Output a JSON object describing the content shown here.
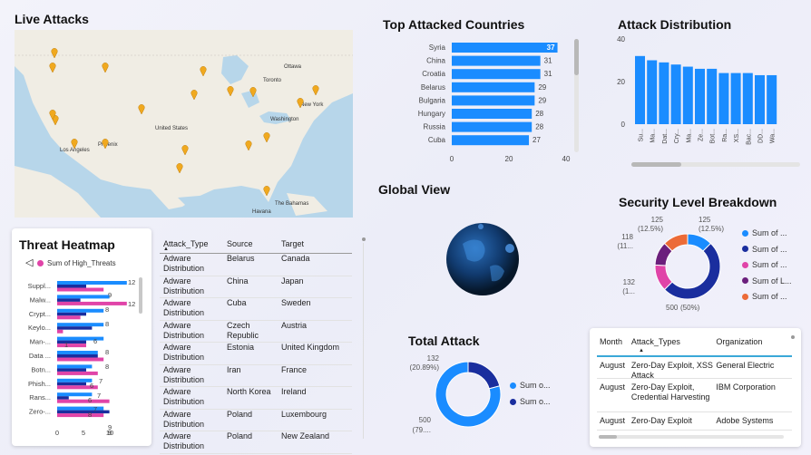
{
  "titles": {
    "live_attacks": "Live Attacks",
    "top_countries": "Top Attacked Countries",
    "attack_distribution": "Attack Distribution",
    "global_view": "Global View",
    "security_level": "Security Level Breakdown",
    "threat_heatmap": "Threat Heatmap",
    "total_attack": "Total Attack"
  },
  "map": {
    "labels": [
      "Ottawa",
      "Toronto",
      "New York",
      "Washington",
      "United States",
      "Los Angeles",
      "Phoenix",
      "The Bahamas",
      "Havana"
    ],
    "pins": 19
  },
  "colors": {
    "bar_blue": "#1a8cff",
    "navy": "#1a2e9e",
    "pink": "#e044a8",
    "purple": "#6b1f7c",
    "orange": "#ec6b37"
  },
  "chart_data": [
    {
      "id": "top_countries",
      "type": "bar",
      "orientation": "horizontal",
      "categories": [
        "Syria",
        "China",
        "Croatia",
        "Belarus",
        "Bulgaria",
        "Hungary",
        "Russia",
        "Cuba"
      ],
      "values": [
        37,
        31,
        31,
        29,
        29,
        28,
        28,
        27
      ],
      "xlim": [
        0,
        40
      ],
      "xticks": [
        "0",
        "20",
        "40"
      ]
    },
    {
      "id": "attack_distribution",
      "type": "bar",
      "categories": [
        "Su...",
        "Ma...",
        "Dat...",
        "Cry...",
        "Ma...",
        "Ze...",
        "Bot...",
        "Ra...",
        "XS...",
        "Bac...",
        "DD...",
        "Wa..."
      ],
      "values": [
        32,
        30,
        29,
        28,
        27,
        26,
        26,
        24,
        24,
        24,
        23,
        23
      ],
      "ylim": [
        0,
        40
      ],
      "yticks": [
        "0",
        "20",
        "40"
      ]
    },
    {
      "id": "security_level",
      "type": "pie",
      "donut": true,
      "slices": [
        {
          "label": "125",
          "pct": "(12.5%)",
          "value": 125,
          "color": "#1a8cff"
        },
        {
          "label": "500",
          "pct": "(50%)",
          "value": 500,
          "color": "#1a2e9e"
        },
        {
          "label": "132",
          "pct": "(1...",
          "value": 132,
          "color": "#e044a8"
        },
        {
          "label": "118",
          "pct": "(11...",
          "value": 118,
          "color": "#6b1f7c"
        },
        {
          "label": "125",
          "pct": "(12.5%)",
          "value": 125,
          "color": "#ec6b37"
        }
      ],
      "legend": [
        "Sum of ...",
        "Sum of ...",
        "Sum of ...",
        "Sum of L...",
        "Sum of ..."
      ]
    },
    {
      "id": "threat_heatmap",
      "type": "bar",
      "orientation": "horizontal",
      "legend": [
        "Sum of High_Threats"
      ],
      "categories": [
        "Suppl...",
        "Malw...",
        "Crypt...",
        "Keylo...",
        "Man-...",
        "Data ...",
        "Botn...",
        "Phish...",
        "Rans...",
        "Zero-..."
      ],
      "series": [
        {
          "color": "#1a8cff",
          "values": [
            12,
            9,
            8,
            8,
            8,
            7,
            6,
            6,
            6,
            8
          ]
        },
        {
          "color": "#1a2e9e",
          "values": [
            5,
            4,
            5,
            6,
            5,
            7,
            5,
            5,
            2,
            9
          ]
        },
        {
          "color": "#e044a8",
          "values": [
            8,
            12,
            4,
            1,
            5,
            8,
            7,
            7,
            9,
            8
          ]
        }
      ],
      "labels": [
        "12",
        "9",
        "12",
        "8",
        "8",
        "6",
        "1",
        "8",
        "8",
        "7",
        "6",
        "7",
        "6",
        "7",
        "8",
        "9",
        "9"
      ],
      "xlim": [
        0,
        10
      ],
      "xticks": [
        "0",
        "5",
        "10"
      ]
    },
    {
      "id": "total_attack",
      "type": "pie",
      "donut": true,
      "slices": [
        {
          "label": "132",
          "pct": "(20.89%)",
          "value": 132,
          "color": "#1a2e9e"
        },
        {
          "label": "500",
          "pct": "(79....",
          "value": 500,
          "color": "#1a8cff"
        }
      ],
      "legend": [
        "Sum o...",
        "Sum o..."
      ]
    }
  ],
  "attack_table": {
    "headers": [
      "Attack_Type",
      "Source",
      "Target"
    ],
    "rows": [
      [
        "Adware Distribution",
        "Belarus",
        "Canada"
      ],
      [
        "Adware Distribution",
        "China",
        "Japan"
      ],
      [
        "Adware Distribution",
        "Cuba",
        "Sweden"
      ],
      [
        "Adware Distribution",
        "Czech Republic",
        "Austria"
      ],
      [
        "Adware Distribution",
        "Estonia",
        "United Kingdom"
      ],
      [
        "Adware Distribution",
        "Iran",
        "France"
      ],
      [
        "Adware Distribution",
        "North Korea",
        "Ireland"
      ],
      [
        "Adware Distribution",
        "Poland",
        "Luxembourg"
      ],
      [
        "Adware Distribution",
        "Poland",
        "New Zealand"
      ]
    ]
  },
  "org_table": {
    "headers": [
      "Month",
      "Attack_Types",
      "Organization"
    ],
    "rows": [
      [
        "August",
        "Zero-Day Exploit, XSS Attack",
        "General Electric"
      ],
      [
        "August",
        "Zero-Day Exploit, Credential Harvesting",
        "IBM Corporation"
      ],
      [
        "August",
        "Zero-Day Exploit",
        "Adobe Systems"
      ]
    ]
  }
}
